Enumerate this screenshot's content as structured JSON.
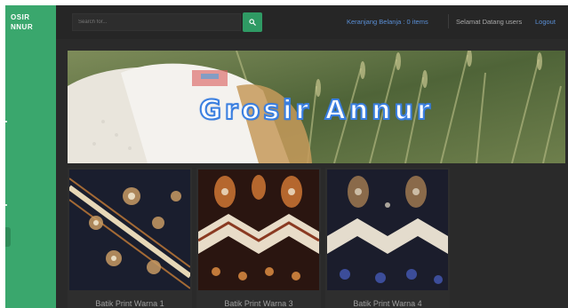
{
  "sidebar": {
    "brand_line1": "OSIR",
    "brand_line2": "NNUR"
  },
  "header": {
    "search_placeholder": "Search for...",
    "cart_text": "Keranjang Belanja : 0 items",
    "welcome_text": "Selamat Datang users",
    "logout_label": "Logout"
  },
  "banner": {
    "title": "Grosir Annur"
  },
  "products": [
    {
      "name": "Batik Print Warna 1"
    },
    {
      "name": "Batik Print Warna 3"
    },
    {
      "name": "Batik Print Warna 4"
    }
  ],
  "colors": {
    "sidebar": "#3aa76d",
    "background": "#2a2a2a",
    "link": "#5a8fd6",
    "search_button": "#2f9a64"
  },
  "icons": {
    "search_button": "search-icon"
  }
}
